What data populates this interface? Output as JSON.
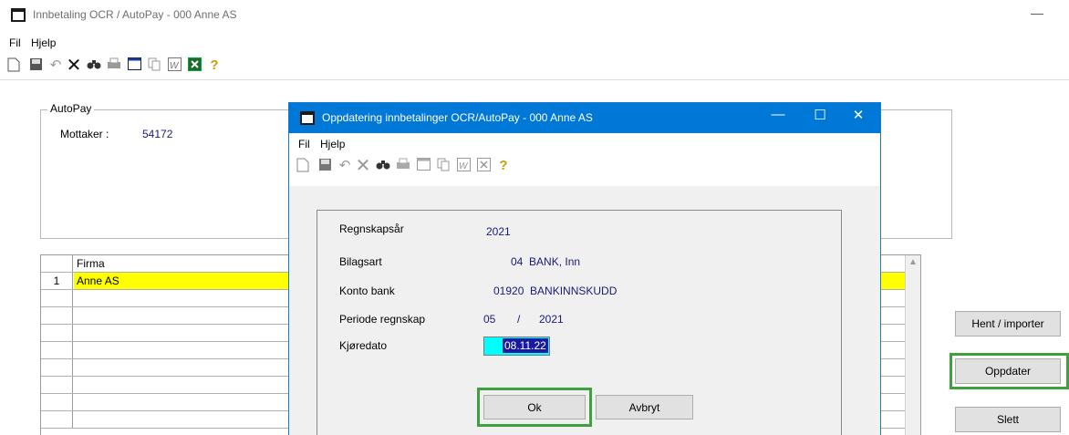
{
  "main": {
    "title": "Innbetaling OCR / AutoPay - 000 Anne AS",
    "minimize_glyph": "—",
    "menu": [
      "Fil",
      "Hjelp"
    ],
    "autopay": {
      "legend": "AutoPay",
      "mottaker_label": "Mottaker :",
      "mottaker_value": "54172"
    },
    "grid": {
      "header": "Firma",
      "rows": [
        {
          "num": "1",
          "firma": "Anne AS"
        }
      ]
    },
    "buttons": {
      "hent": "Hent / importer",
      "oppdater": "Oppdater",
      "slett": "Slett"
    }
  },
  "dialog": {
    "title": "Oppdatering innbetalinger OCR/AutoPay - 000 Anne AS",
    "menu": [
      "Fil",
      "Hjelp"
    ],
    "fields": {
      "regnskapsar_label": "Regnskapsår",
      "regnskapsar_value": "2021",
      "bilagsart_label": "Bilagsart",
      "bilagsart_value": "04  BANK, Inn",
      "konto_label": "Konto bank",
      "konto_value": "01920  BANKINNSKUDD",
      "periode_label": "Periode regnskap",
      "periode_month": "05",
      "periode_sep": "/",
      "periode_year": "2021",
      "kjoredato_label": "Kjøredato",
      "kjoredato_value": "08.11.22"
    },
    "buttons": {
      "ok": "Ok",
      "avbryt": "Avbryt"
    }
  },
  "icons": [
    "new-file-icon",
    "save-icon",
    "undo-icon",
    "delete-icon",
    "find-icon",
    "print-icon",
    "calendar-icon",
    "copy-icon",
    "word-icon",
    "excel-icon",
    "help-icon"
  ],
  "colors": {
    "dialog_titlebar": "#0078d7",
    "selected_row": "#ffff00",
    "date_field": "#00ffff",
    "highlight_frame": "#3ea13e"
  }
}
